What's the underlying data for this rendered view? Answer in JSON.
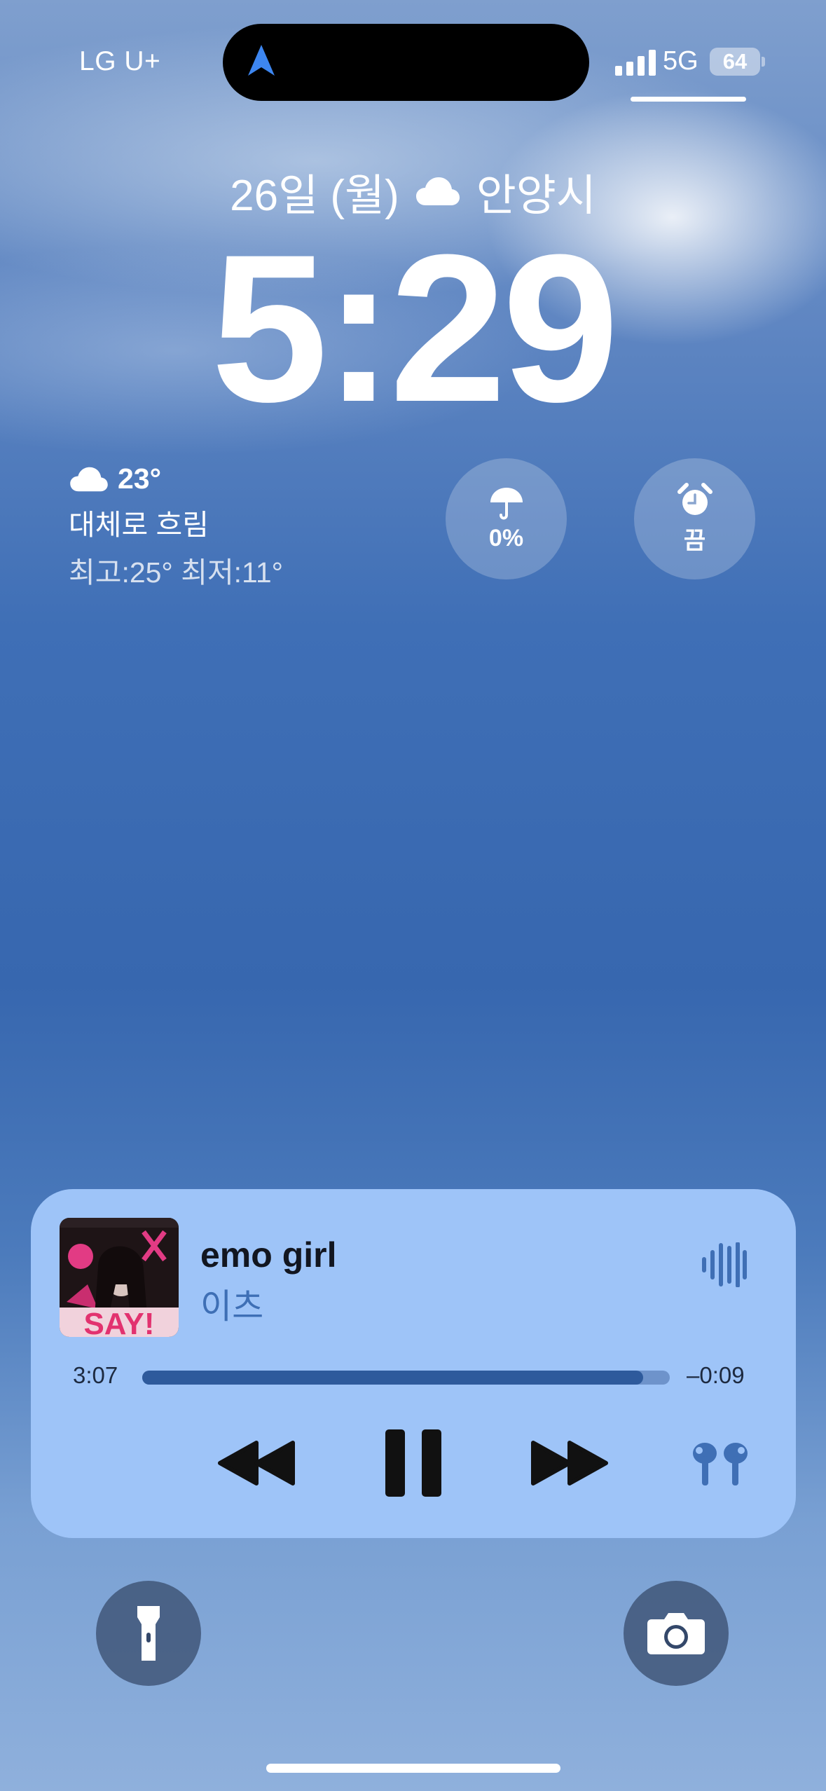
{
  "status_bar": {
    "carrier": "LG U+",
    "network": "5G",
    "battery": "64",
    "signal_bars": 4,
    "active_icon": "navigation-arrow-icon"
  },
  "lock": {
    "date": "26일 (월)",
    "location": "안양시",
    "time": "5:29",
    "weather_icon": "cloud-icon"
  },
  "widgets": {
    "weather": {
      "temp": "23°",
      "condition": "대체로 흐림",
      "high_low": "최고:25° 최저:11°"
    },
    "rain": {
      "icon": "umbrella-icon",
      "value": "0%"
    },
    "alarm": {
      "icon": "alarm-clock-icon",
      "value": "끔"
    }
  },
  "now_playing": {
    "title": "emo girl",
    "artist": "이츠",
    "elapsed": "3:07",
    "remaining": "–0:09",
    "progress": 0.95,
    "album_art_text": "SAY!",
    "colors": {
      "card": "#9ec4f8",
      "track": "#6e93cb",
      "fill": "#2e5a9c",
      "accent": "#3e6fb5"
    }
  },
  "quick_actions": {
    "left": "flashlight-icon",
    "right": "camera-icon"
  }
}
